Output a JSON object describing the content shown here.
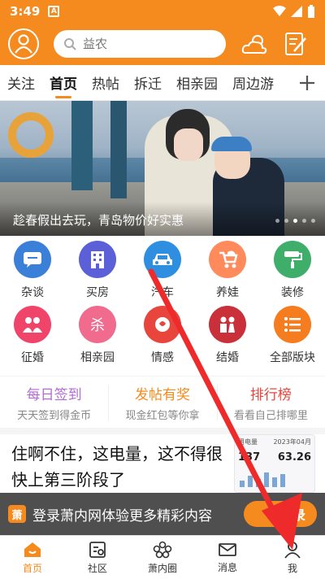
{
  "status_bar": {
    "time": "3:49",
    "note_icon": "A"
  },
  "header": {
    "search_placeholder": "益农",
    "colors": {
      "brand": "#f58b1f"
    }
  },
  "tabs": [
    {
      "label": "关注"
    },
    {
      "label": "首页"
    },
    {
      "label": "热帖"
    },
    {
      "label": "拆迁"
    },
    {
      "label": "相亲园"
    },
    {
      "label": "周边游"
    }
  ],
  "banner": {
    "caption": "趁春假出去玩，青岛物价好实惠"
  },
  "grid": {
    "items": [
      {
        "label": "杂谈",
        "color": "#3a7fd8"
      },
      {
        "label": "买房",
        "color": "#5b5fd8"
      },
      {
        "label": "汽车",
        "color": "#2e8fe0"
      },
      {
        "label": "养娃",
        "color": "#ff8a5b"
      },
      {
        "label": "装修",
        "color": "#3fae6a"
      },
      {
        "label": "征婚",
        "color": "#f0446a"
      },
      {
        "label": "相亲园",
        "color": "#f06b8e"
      },
      {
        "label": "情感",
        "color": "#e8453c"
      },
      {
        "label": "结婚",
        "color": "#c9303a"
      },
      {
        "label": "全部版块",
        "color": "#f57c1f"
      }
    ]
  },
  "promo": [
    {
      "title": "每日签到",
      "sub": "天天签到得金币",
      "color": "#b46ad6"
    },
    {
      "title": "发帖有奖",
      "sub": "现金红包等你拿",
      "color": "#f58b1f"
    },
    {
      "title": "排行榜",
      "sub": "看看自己排哪里",
      "color": "#e8453c"
    }
  ],
  "article": {
    "title": "住啊不住，这电量，这不得很快上第三阶段了",
    "thumb": {
      "head_left": "用电量",
      "head_right": "2023年04月",
      "num1": "137",
      "num2": "63.26"
    }
  },
  "login_bar": {
    "logo": "萧",
    "text": "登录萧内网体验更多精彩内容",
    "button": "登录"
  },
  "bottom_nav": [
    {
      "label": "首页"
    },
    {
      "label": "社区"
    },
    {
      "label": "萧内圈"
    },
    {
      "label": "消息"
    },
    {
      "label": "我"
    }
  ]
}
